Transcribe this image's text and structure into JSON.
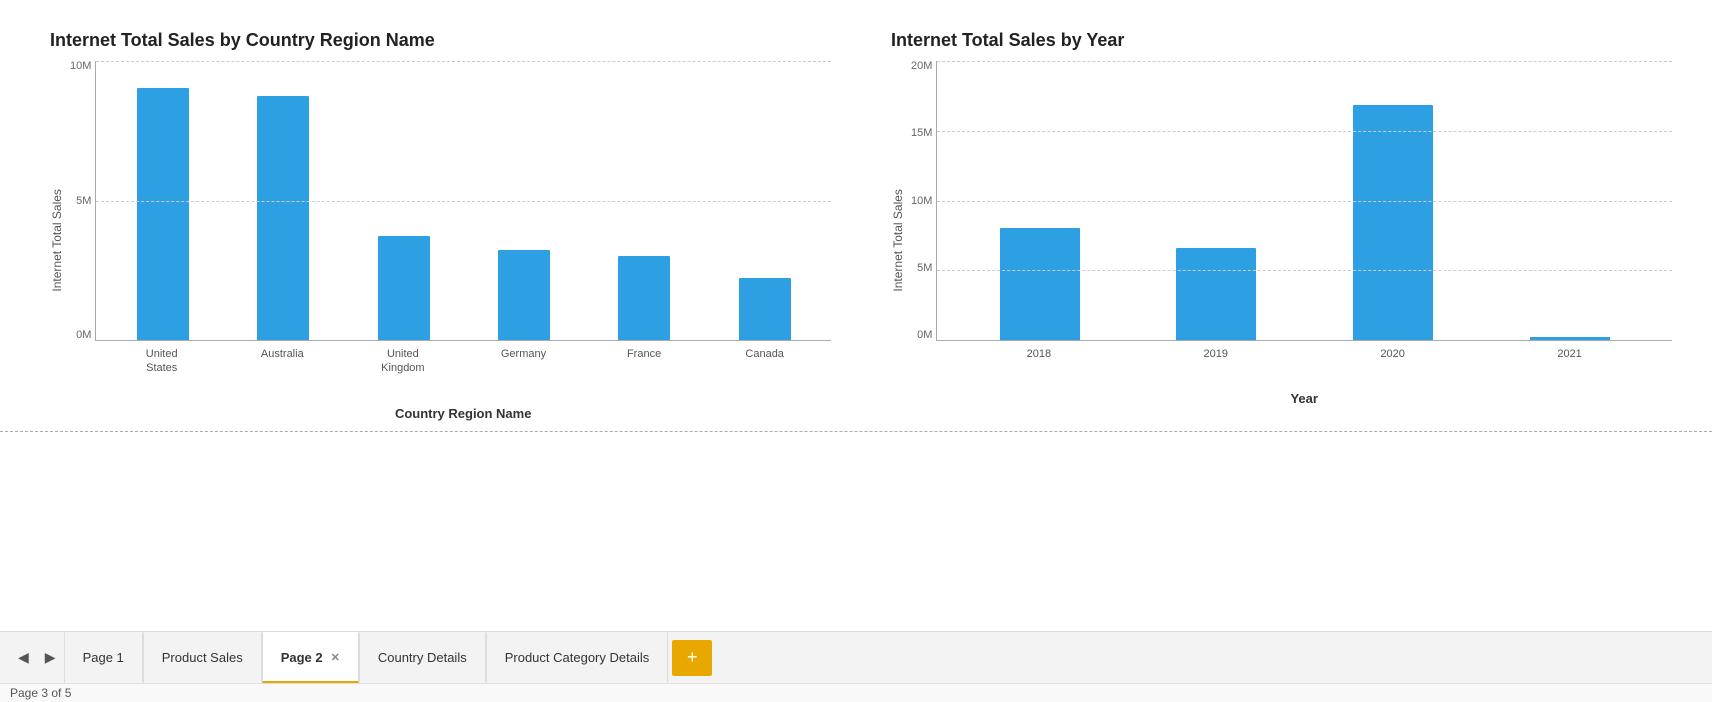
{
  "charts": {
    "left": {
      "title": "Internet Total Sales by Country Region Name",
      "y_axis_label": "Internet Total Sales",
      "x_axis_label": "Country Region Name",
      "y_ticks": [
        "10M",
        "5M",
        "0M"
      ],
      "bars": [
        {
          "label": "United\nStates",
          "height_pct": 90
        },
        {
          "label": "Australia",
          "height_pct": 87
        },
        {
          "label": "United\nKingdom",
          "height_pct": 37
        },
        {
          "label": "Germany",
          "height_pct": 32
        },
        {
          "label": "France",
          "height_pct": 30
        },
        {
          "label": "Canada",
          "height_pct": 22
        }
      ]
    },
    "right": {
      "title": "Internet Total Sales by Year",
      "y_axis_label": "Internet Total Sales",
      "x_axis_label": "Year",
      "y_ticks": [
        "20M",
        "15M",
        "10M",
        "5M",
        "0M"
      ],
      "bars": [
        {
          "label": "2018",
          "height_pct": 40,
          "type": "bar"
        },
        {
          "label": "2019",
          "height_pct": 33,
          "type": "bar"
        },
        {
          "label": "2020",
          "height_pct": 84,
          "type": "bar"
        },
        {
          "label": "2021",
          "height_pct": 0,
          "type": "line"
        }
      ]
    }
  },
  "tabs": {
    "nav_prev_label": "◀",
    "nav_next_label": "▶",
    "items": [
      {
        "label": "Page 1",
        "active": false,
        "closeable": false
      },
      {
        "label": "Product Sales",
        "active": false,
        "closeable": false
      },
      {
        "label": "Page 2",
        "active": true,
        "closeable": true
      },
      {
        "label": "Country Details",
        "active": false,
        "closeable": false
      },
      {
        "label": "Product Category Details",
        "active": false,
        "closeable": false
      }
    ],
    "add_button_label": "+",
    "status_text": "Page 3 of 5"
  }
}
